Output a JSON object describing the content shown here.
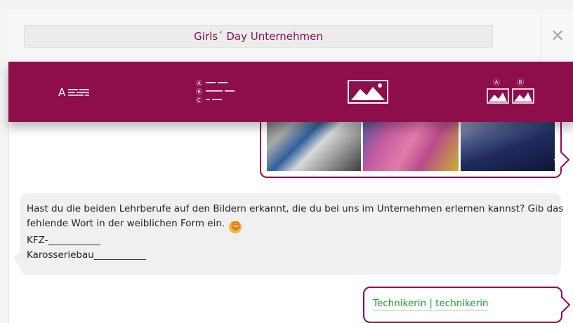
{
  "dialog": {
    "title": "Girls´ Day Unternehmen",
    "close_symbol": "✕"
  },
  "toolbar": {
    "background": "#8e0d4b",
    "buttons": [
      {
        "icon": "text-lines-icon",
        "glyph": "A"
      },
      {
        "icon": "multiple-choice-icon",
        "options": [
          "Ⓐ",
          "Ⓑ",
          "Ⓒ"
        ]
      },
      {
        "icon": "image-icon"
      },
      {
        "icon": "image-choice-icon",
        "options": [
          "Ⓐ",
          "Ⓑ"
        ]
      }
    ]
  },
  "chat": {
    "image_message": {
      "photos": [
        "multimeter-photo",
        "fabric-photo",
        "blue-fabric-photo"
      ]
    },
    "bot_message": {
      "line1": "Hast du die beiden Lehrberufe auf den Bildern erkannt, die du bei uns im Unternehmen erlernen kannst? Gib das",
      "line2": "fehlende Wort in der weiblichen Form ein.",
      "emoji": "☺",
      "line3": "KFZ-___________",
      "line4": "Karosseriebau___________"
    },
    "user_answer": "Technikerin | technikerin"
  },
  "colors": {
    "accent": "#8e0d4b",
    "answer_text": "#1f9a2b",
    "bubble_bg": "#f0f0f0"
  }
}
